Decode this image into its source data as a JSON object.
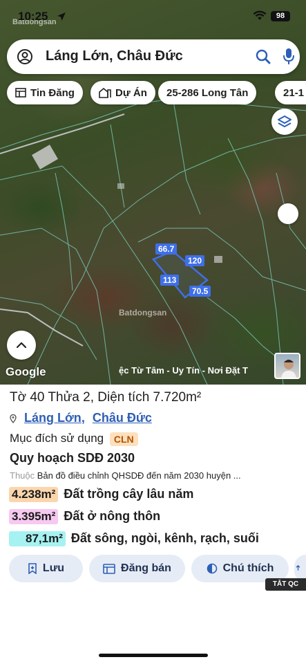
{
  "status_bar": {
    "time": "10:25",
    "battery": "98"
  },
  "watermark": "Batdongsan",
  "search": {
    "query": "Láng Lớn, Châu Đức"
  },
  "chips": [
    {
      "label": "Tin Đăng",
      "icon": "listing-icon"
    },
    {
      "label": "Dự Án",
      "icon": "project-icon"
    },
    {
      "label": "25-286 Long Tân"
    },
    {
      "label": "21-1"
    }
  ],
  "map": {
    "plot_labels": {
      "top": "66.7",
      "right": "120",
      "left": "113",
      "bottom": "70.5"
    },
    "attribution": "Google",
    "ticker": "ệc Từ Tâm - Uy Tín - Nơi Đặt T"
  },
  "parcel": {
    "title": "Tờ 40 Thửa 2, Diện tích 7.720m²",
    "location_part1": "Láng Lớn",
    "location_sep": ",",
    "location_part2": "Châu Đức",
    "purpose_label": "Mục đích sử dụng",
    "purpose_code": "CLN",
    "plan_title": "Quy hoạch SDĐ 2030",
    "plan_prefix": "Thuộc",
    "plan_desc": "Bản đồ điều chỉnh QHSDĐ đến năm 2030 huyện ...",
    "land_uses": [
      {
        "area": "4.238m²",
        "label": "Đất trồng cây lâu năm",
        "color": "#fbd6ad"
      },
      {
        "area": "3.395m²",
        "label": "Đất ở nông thôn",
        "color": "#f6c9f0"
      },
      {
        "area": "87,1m²",
        "label": "Đất sông, ngòi, kênh, rạch, suối",
        "color": "#a6f2f2"
      }
    ]
  },
  "actions": {
    "save": "Lưu",
    "post": "Đăng bán",
    "legend": "Chú thích"
  },
  "ad_tag": "TẮT QC"
}
